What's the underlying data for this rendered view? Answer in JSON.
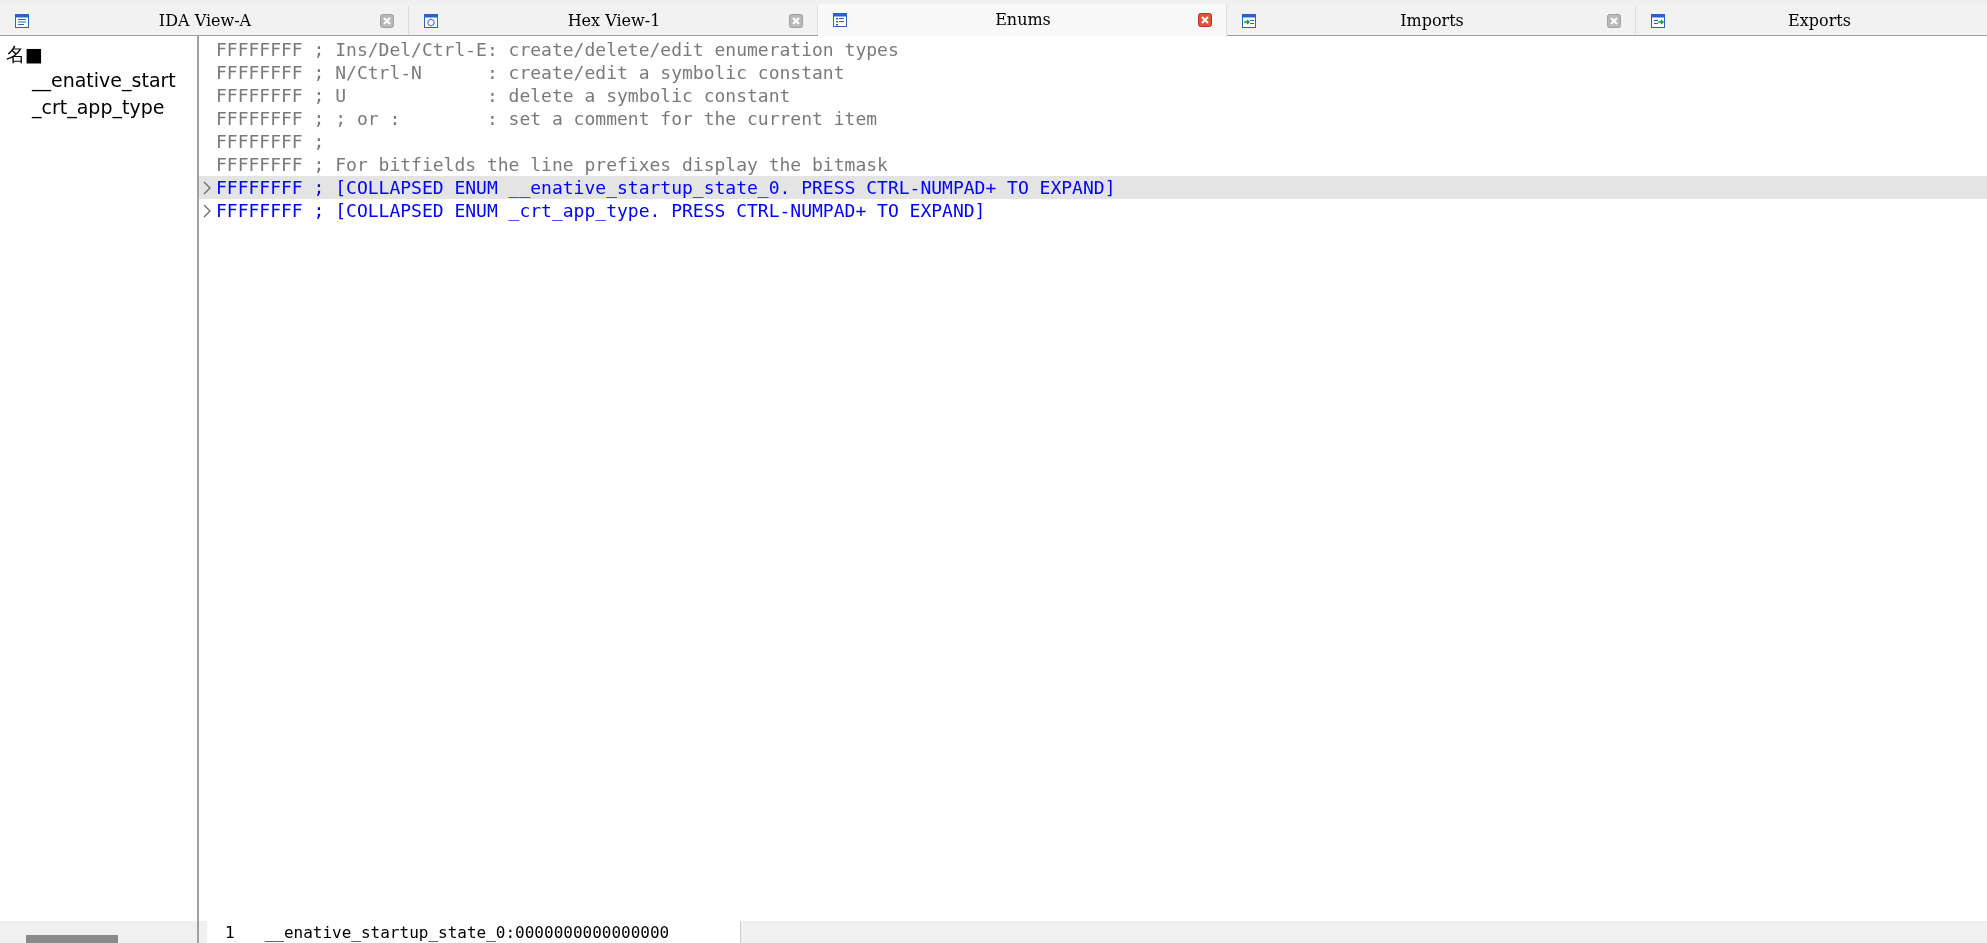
{
  "tabs": [
    {
      "label": "IDA View-A",
      "selected": false,
      "closable": true
    },
    {
      "label": "Hex View-1",
      "selected": false,
      "closable": true
    },
    {
      "label": "Enums",
      "selected": true,
      "closable": true
    },
    {
      "label": "Imports",
      "selected": false,
      "closable": true
    },
    {
      "label": "Exports",
      "selected": false,
      "closable": false
    }
  ],
  "sidebar": {
    "header": "名■",
    "items": [
      "__enative_start",
      "_crt_app_type"
    ]
  },
  "lines": [
    {
      "kind": "comment",
      "text": "FFFFFFFF ; Ins/Del/Ctrl-E: create/delete/edit enumeration types",
      "selected": false
    },
    {
      "kind": "comment",
      "text": "FFFFFFFF ; N/Ctrl-N      : create/edit a symbolic constant",
      "selected": false
    },
    {
      "kind": "comment",
      "text": "FFFFFFFF ; U             : delete a symbolic constant",
      "selected": false
    },
    {
      "kind": "comment",
      "text": "FFFFFFFF ; ; or :        : set a comment for the current item",
      "selected": false
    },
    {
      "kind": "comment",
      "text": "FFFFFFFF ;",
      "selected": false
    },
    {
      "kind": "comment",
      "text": "FFFFFFFF ; For bitfields the line prefixes display the bitmask",
      "selected": false
    },
    {
      "kind": "collapsed",
      "text": "FFFFFFFF ; [COLLAPSED ENUM __enative_startup_state_0. PRESS CTRL-NUMPAD+ TO EXPAND]",
      "selected": true
    },
    {
      "kind": "collapsed",
      "text": "FFFFFFFF ; [COLLAPSED ENUM _crt_app_type. PRESS CTRL-NUMPAD+ TO EXPAND]",
      "selected": false
    }
  ],
  "status_bar": {
    "line_number": "1",
    "location": "__enative_startup_state_0:0000000000000000"
  }
}
